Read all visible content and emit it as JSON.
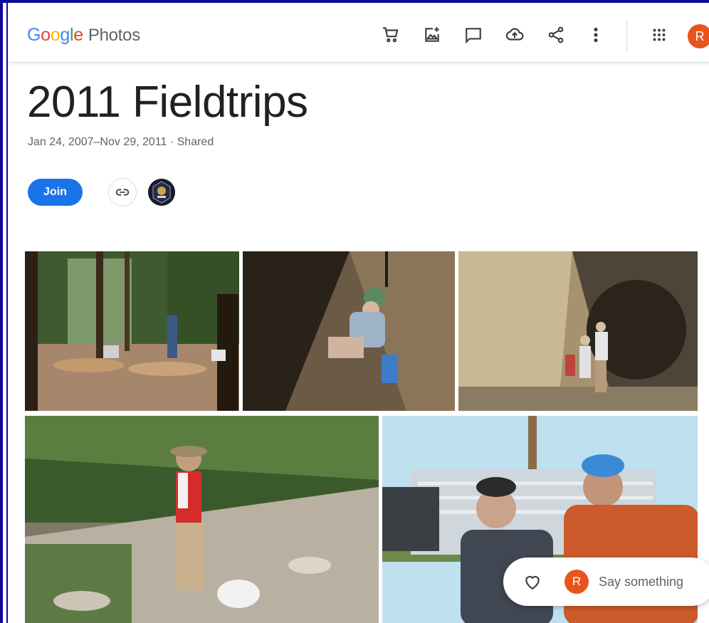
{
  "header": {
    "logo": {
      "g": "G",
      "o1": "o",
      "o2": "o",
      "g2": "g",
      "l": "l",
      "e": "e",
      "product": "Photos"
    },
    "icons": [
      "cart-icon",
      "add-photo-icon",
      "comment-icon",
      "cloud-upload-icon",
      "share-icon",
      "more-vert-icon",
      "apps-grid-icon"
    ],
    "avatar_letter": "R",
    "avatar_color": "#e8541d"
  },
  "album": {
    "title": "2011 Fieldtrips",
    "subtitle": "Jan 24, 2007–Nov 29, 2011 · Shared",
    "join_label": "Join"
  },
  "photos": [
    {
      "name": "photo-forest-dig"
    },
    {
      "name": "photo-hole-digger"
    },
    {
      "name": "photo-cave-hikers"
    },
    {
      "name": "photo-rocky-slope"
    },
    {
      "name": "photo-truck-friends"
    }
  ],
  "comment": {
    "avatar_letter": "R",
    "placeholder": "Say something"
  },
  "colors": {
    "accent": "#1a73e8",
    "avatar": "#e8541d",
    "frame": "#0a0a9c"
  }
}
